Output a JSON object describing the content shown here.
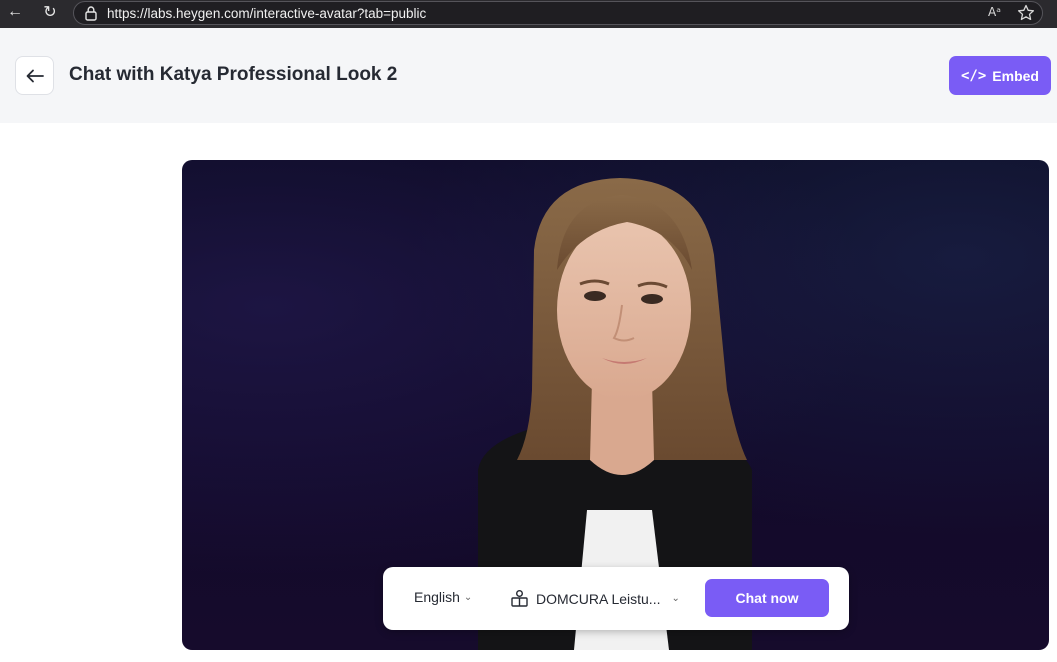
{
  "browser": {
    "url": "https://labs.heygen.com/interactive-avatar?tab=public",
    "read_aloud_glyph": "Aᵃ"
  },
  "header": {
    "title": "Chat with Katya Professional Look 2",
    "embed_label": "Embed",
    "embed_icon": "</>"
  },
  "controls": {
    "language": "English",
    "knowledge_base": "DOMCURA Leistu...",
    "chat_label": "Chat now"
  },
  "colors": {
    "accent": "#7a5cf5",
    "header_bg": "#f5f6f8",
    "panel_bg": "#0c0a22"
  }
}
